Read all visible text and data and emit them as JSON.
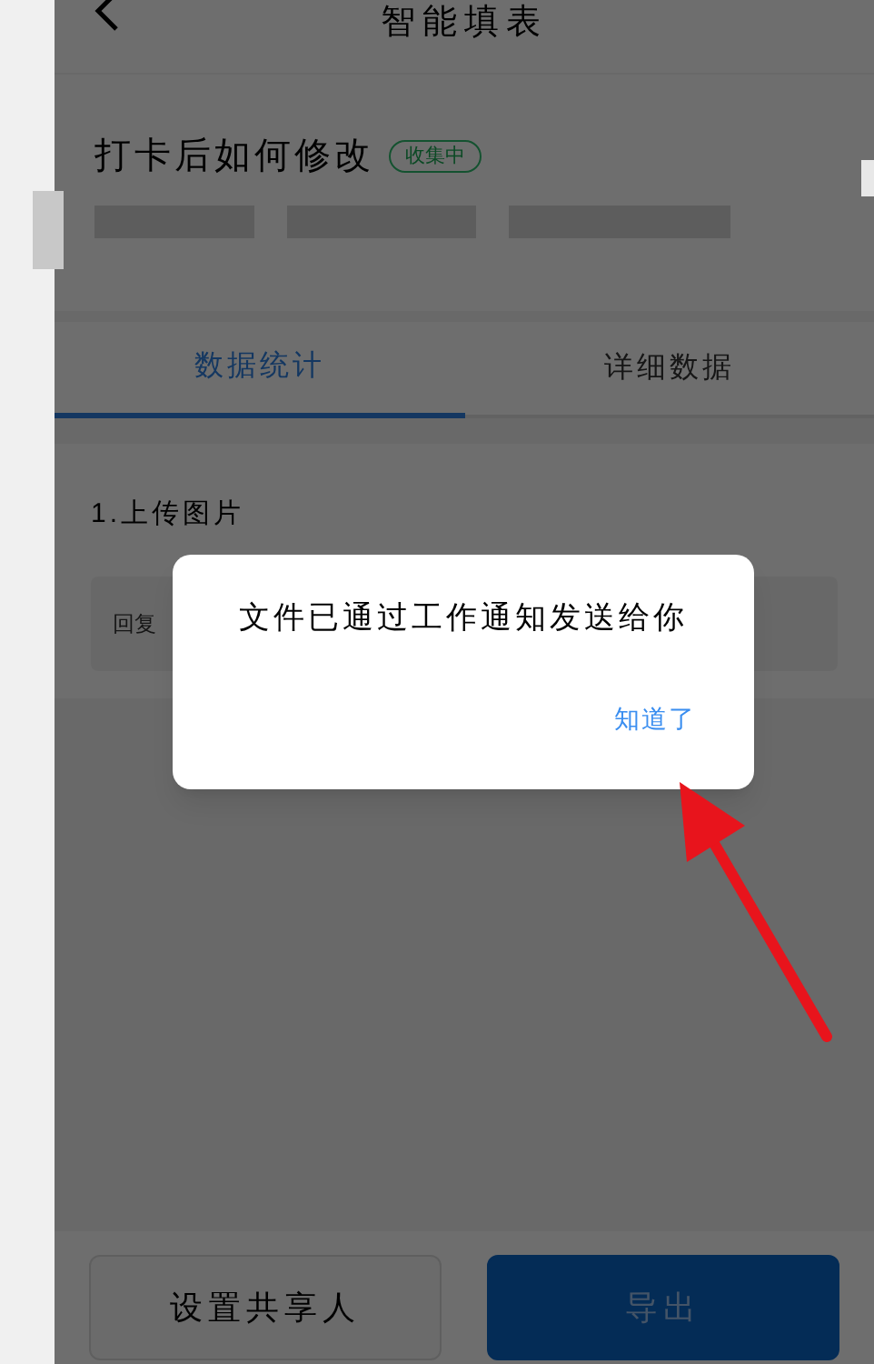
{
  "header": {
    "title": "智能填表"
  },
  "form": {
    "title": "打卡后如何修改",
    "status": "收集中"
  },
  "tabs": [
    {
      "label": "数据统计",
      "selected": true
    },
    {
      "label": "详细数据",
      "selected": false
    }
  ],
  "question": {
    "title": "1.上传图片",
    "reply": "回复"
  },
  "dialog": {
    "message": "文件已通过工作通知发送给你",
    "action": "知道了"
  },
  "buttons": [
    {
      "label": "设置共享人",
      "kind": "secondary"
    },
    {
      "label": "导出",
      "kind": "primary"
    }
  ]
}
